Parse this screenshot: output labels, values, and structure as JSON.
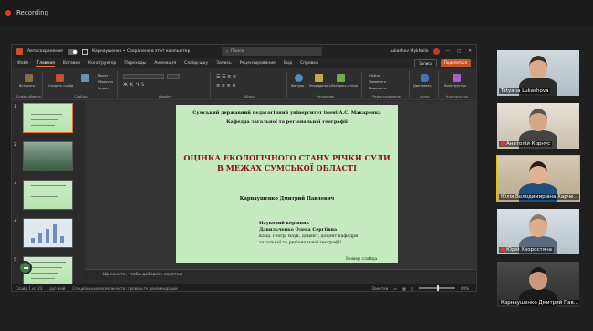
{
  "recording_label": "Recording",
  "titlebar": {
    "autosave_label": "Автосохранение",
    "file_title": "Карнаушенко • Сохранено в этот компьютер",
    "search_placeholder": "Поиск",
    "user_name": "Lukashov Mykhailo",
    "win_controls": [
      "—",
      "▢",
      "✕"
    ]
  },
  "menu": {
    "items": [
      "Файл",
      "Главная",
      "Вставка",
      "Конструктор",
      "Переходы",
      "Анимация",
      "Слайд-шоу",
      "Запись",
      "Рецензирование",
      "Вид",
      "Справка"
    ],
    "active_index": 1,
    "record_btn": "Запись",
    "share_btn": "Поделиться"
  },
  "ribbon_groups": [
    "Буфер обмена",
    "Слайды",
    "Шрифт",
    "Абзац",
    "Рисование",
    "Редактирование",
    "Голос",
    "Конструктор"
  ],
  "ribbon_buttons": {
    "paste": "Вставить",
    "new_slide": "Создать слайд",
    "reuse_slides": "Повторно использовать слайды",
    "layout": "Макет",
    "reset": "Сбросить",
    "section": "Раздел",
    "shapes": "Фигуры",
    "arrange": "Упорядочить",
    "quick_styles": "Экспресс-стили",
    "find": "Найти",
    "replace": "Заменить",
    "select": "Выделить",
    "dictate": "Диктовать",
    "designer": "Конструктор"
  },
  "thumbnails": [
    {
      "num": "1",
      "kind": "green",
      "selected": true
    },
    {
      "num": "2",
      "kind": "photo",
      "selected": false
    },
    {
      "num": "3",
      "kind": "green",
      "selected": false
    },
    {
      "num": "4",
      "kind": "chart",
      "selected": false
    },
    {
      "num": "5",
      "kind": "green",
      "selected": false
    }
  ],
  "slide": {
    "university": "Сумський державний педагогічний університет імені А.С. Макаренка",
    "department": "Кафедра загальної та регіональної географії",
    "title_line1": "ОЦІНКА ЕКОЛОГІЧНОГО СТАНУ РІЧКИ СУЛИ",
    "title_line2": "В МЕЖАХ СУМСЬКОЇ ОБЛАСТІ",
    "author": "Карнаушенко Дмитрий Павлович",
    "supervisor_label": "Науковий керівник",
    "supervisor_name": "Данильченко  Олена Сергіївна",
    "supervisor_degree_1": "канд. геогр. наук, доцент, доцент кафедри",
    "supervisor_degree_2": "загальної та регіональної географії",
    "slide_number_field": "Номер слайда"
  },
  "notes_placeholder": "Щелкните, чтобы добавить заметки",
  "statusbar": {
    "slide_info": "Слайд 1 из 23",
    "language": "русский",
    "accessibility": "Специальные возможности: проверьте рекомендации",
    "notes_btn": "Заметки",
    "zoom": "64%"
  },
  "participants": [
    {
      "name": "Tetyana Lukashova",
      "muted": false,
      "speaking": false
    },
    {
      "name": "Анатолій Корнус",
      "muted": true,
      "speaking": false
    },
    {
      "name": "Юлія Володимирівна Харче...",
      "muted": false,
      "speaking": true
    },
    {
      "name": "Юрій Хворостяна",
      "muted": true,
      "speaking": false
    },
    {
      "name": "Карнаушенко Дмитрий Пав...",
      "muted": false,
      "speaking": false
    }
  ],
  "colors": {
    "slide_bg": "#c5eabf",
    "title_red": "#8a1410",
    "accent_orange": "#e8723a",
    "speaker_yellow": "#e0c400"
  }
}
